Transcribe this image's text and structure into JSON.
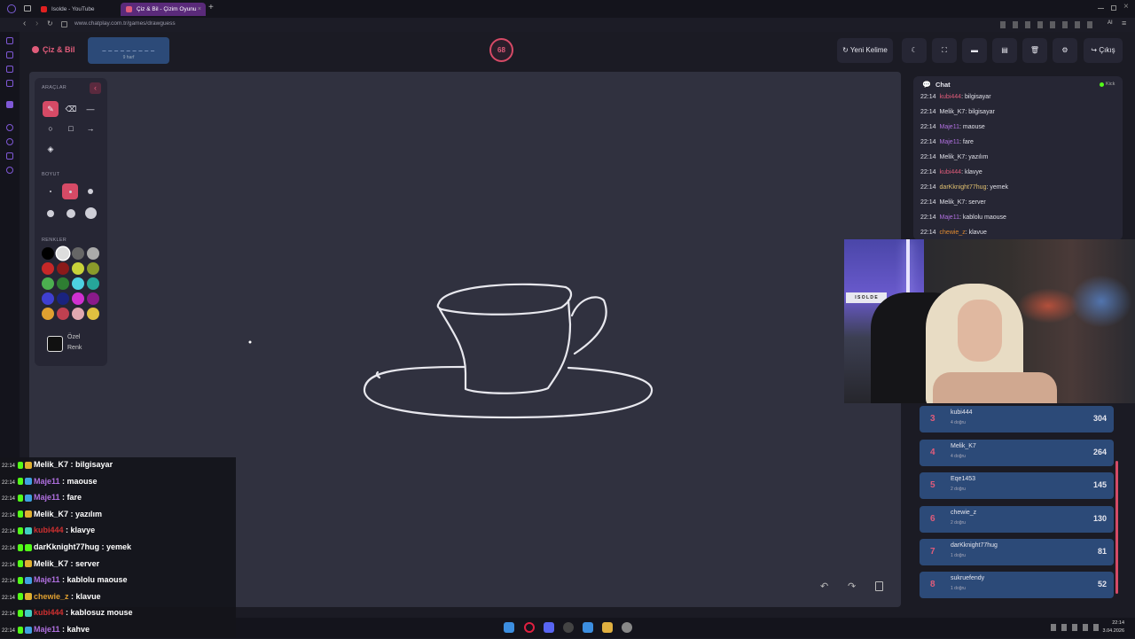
{
  "browser": {
    "tabs": [
      {
        "label": "Isolde - YouTube",
        "active": false
      },
      {
        "label": "Çiz & Bil - Çizim Oyunu",
        "active": true
      }
    ],
    "new_tab": "+",
    "url": "www.chatplay.com.tr/games/drawguess",
    "ai_label": "AI"
  },
  "app": {
    "logo": "Çiz & Bil",
    "word_hint": "_ _ _ _ _ _ _ _ _",
    "letter_count": "9 harf",
    "timer": "68",
    "new_word": "Yeni Kelime",
    "exit": "Çıkış"
  },
  "tools": {
    "heading": "ARAÇLAR",
    "size_heading": "BOYUT",
    "colors_heading": "RENKLER",
    "custom_color_line1": "Özel",
    "custom_color_line2": "Renk",
    "palette": [
      "#000000",
      "#dddddd",
      "#666666",
      "#aaaaaa",
      "#c62828",
      "#8b1a1a",
      "#c8d23a",
      "#8a9a2a",
      "#4caf50",
      "#2e7d32",
      "#4dd0e1",
      "#26a69a",
      "#3f3fd0",
      "#1a237e",
      "#d030d0",
      "#8a1a8a",
      "#e0a030",
      "#c04050",
      "#e0a8b0",
      "#e0c040"
    ]
  },
  "chat": {
    "title": "Chat",
    "status": "Kick",
    "messages": [
      {
        "time": "22:14",
        "user": "kubi444",
        "text": "bilgisayar",
        "color": "#e05c7a"
      },
      {
        "time": "22:14",
        "user": "Melik_K7",
        "text": "bilgisayar",
        "color": "#e0e0e8"
      },
      {
        "time": "22:14",
        "user": "Maje11",
        "text": "maouse",
        "color": "#b070e0"
      },
      {
        "time": "22:14",
        "user": "Maje11",
        "text": "fare",
        "color": "#b070e0"
      },
      {
        "time": "22:14",
        "user": "Melik_K7",
        "text": "yazılım",
        "color": "#e0e0e8"
      },
      {
        "time": "22:14",
        "user": "kubi444",
        "text": "klavye",
        "color": "#e05c7a"
      },
      {
        "time": "22:14",
        "user": "darKknight77hug",
        "text": "yemek",
        "color": "#e0c070"
      },
      {
        "time": "22:14",
        "user": "Melik_K7",
        "text": "server",
        "color": "#e0e0e8"
      },
      {
        "time": "22:14",
        "user": "Maje11",
        "text": "kablolu maouse",
        "color": "#b070e0"
      },
      {
        "time": "22:14",
        "user": "chewie_z",
        "text": "klavue",
        "color": "#e08a30"
      }
    ]
  },
  "leaderboard": [
    {
      "rank": "3",
      "name": "kubi444",
      "sub": "4 doğru",
      "score": "304"
    },
    {
      "rank": "4",
      "name": "Melik_K7",
      "sub": "4 doğru",
      "score": "264"
    },
    {
      "rank": "5",
      "name": "Eqe1453",
      "sub": "2 doğru",
      "score": "145"
    },
    {
      "rank": "6",
      "name": "chewie_z",
      "sub": "2 doğru",
      "score": "130"
    },
    {
      "rank": "7",
      "name": "darKknight77hug",
      "sub": "1 doğru",
      "score": "81"
    },
    {
      "rank": "8",
      "name": "sukruefendy",
      "sub": "1 doğru",
      "score": "52"
    }
  ],
  "overlay_chat": [
    {
      "time": "22:14",
      "user": "Melik_K7",
      "text": "bilgisayar",
      "color": "#ffffff",
      "badge": "#e0b030"
    },
    {
      "time": "22:14",
      "user": "Maje11",
      "text": "maouse",
      "color": "#b070e0",
      "badge": "#3fa0e0"
    },
    {
      "time": "22:14",
      "user": "Maje11",
      "text": "fare",
      "color": "#b070e0",
      "badge": "#3fa0e0"
    },
    {
      "time": "22:14",
      "user": "Melik_K7",
      "text": "yazılım",
      "color": "#ffffff",
      "badge": "#e0b030"
    },
    {
      "time": "22:14",
      "user": "kubi444",
      "text": "klavye",
      "color": "#d03030",
      "badge": "#40d0c0"
    },
    {
      "time": "22:14",
      "user": "darKknight77hug",
      "text": "yemek",
      "color": "#ffffff",
      "badge": "#53fc18"
    },
    {
      "time": "22:14",
      "user": "Melik_K7",
      "text": "server",
      "color": "#ffffff",
      "badge": "#e0b030"
    },
    {
      "time": "22:14",
      "user": "Maje11",
      "text": "kablolu maouse",
      "color": "#b070e0",
      "badge": "#3fa0e0"
    },
    {
      "time": "22:14",
      "user": "chewie_z",
      "text": "klavue",
      "color": "#e0a030",
      "badge": "#e0b030"
    },
    {
      "time": "22:14",
      "user": "kubi444",
      "text": "kablosuz mouse",
      "color": "#d03030",
      "badge": "#40d0c0"
    },
    {
      "time": "22:14",
      "user": "Maje11",
      "text": "kahve",
      "color": "#b070e0",
      "badge": "#3fa0e0"
    }
  ],
  "webcam": {
    "sign": "I S O L D E"
  },
  "taskbar": {
    "time": "22:14",
    "date": "3.04.2026"
  }
}
